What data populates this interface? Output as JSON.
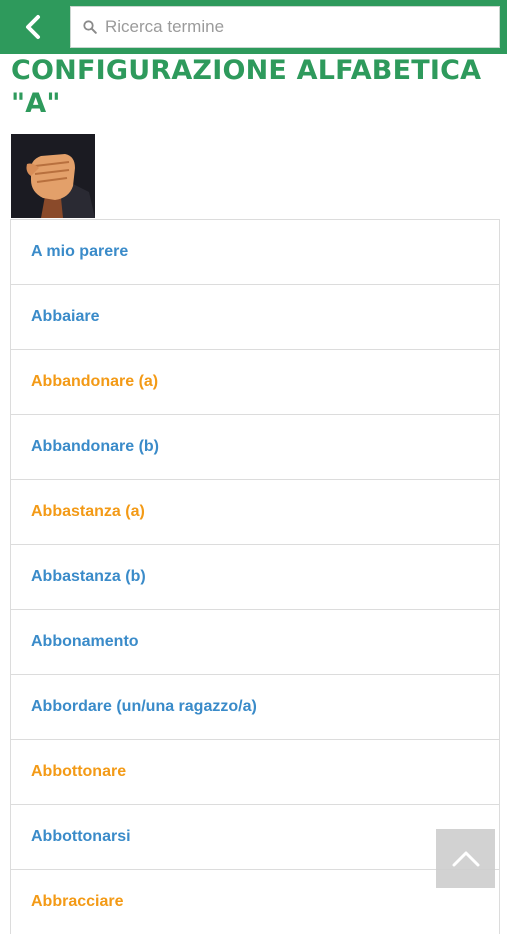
{
  "header": {
    "search_placeholder": "Ricerca termine"
  },
  "page": {
    "title": "CONFIGURAZIONE ALFABETICA \"A\""
  },
  "colors": {
    "brand_green": "#2e9a5c",
    "link_blue": "#3a8bc9",
    "link_orange": "#f39a16"
  },
  "terms": [
    {
      "label": "A mio parere",
      "color": "blue"
    },
    {
      "label": "Abbaiare",
      "color": "blue"
    },
    {
      "label": "Abbandonare (a)",
      "color": "orange"
    },
    {
      "label": "Abbandonare (b)",
      "color": "blue"
    },
    {
      "label": "Abbastanza (a)",
      "color": "orange"
    },
    {
      "label": "Abbastanza (b)",
      "color": "blue"
    },
    {
      "label": "Abbonamento",
      "color": "blue"
    },
    {
      "label": "Abbordare (un/una ragazzo/a)",
      "color": "blue"
    },
    {
      "label": "Abbottonare",
      "color": "orange"
    },
    {
      "label": "Abbottonarsi",
      "color": "blue"
    },
    {
      "label": "Abbracciare",
      "color": "orange"
    }
  ]
}
